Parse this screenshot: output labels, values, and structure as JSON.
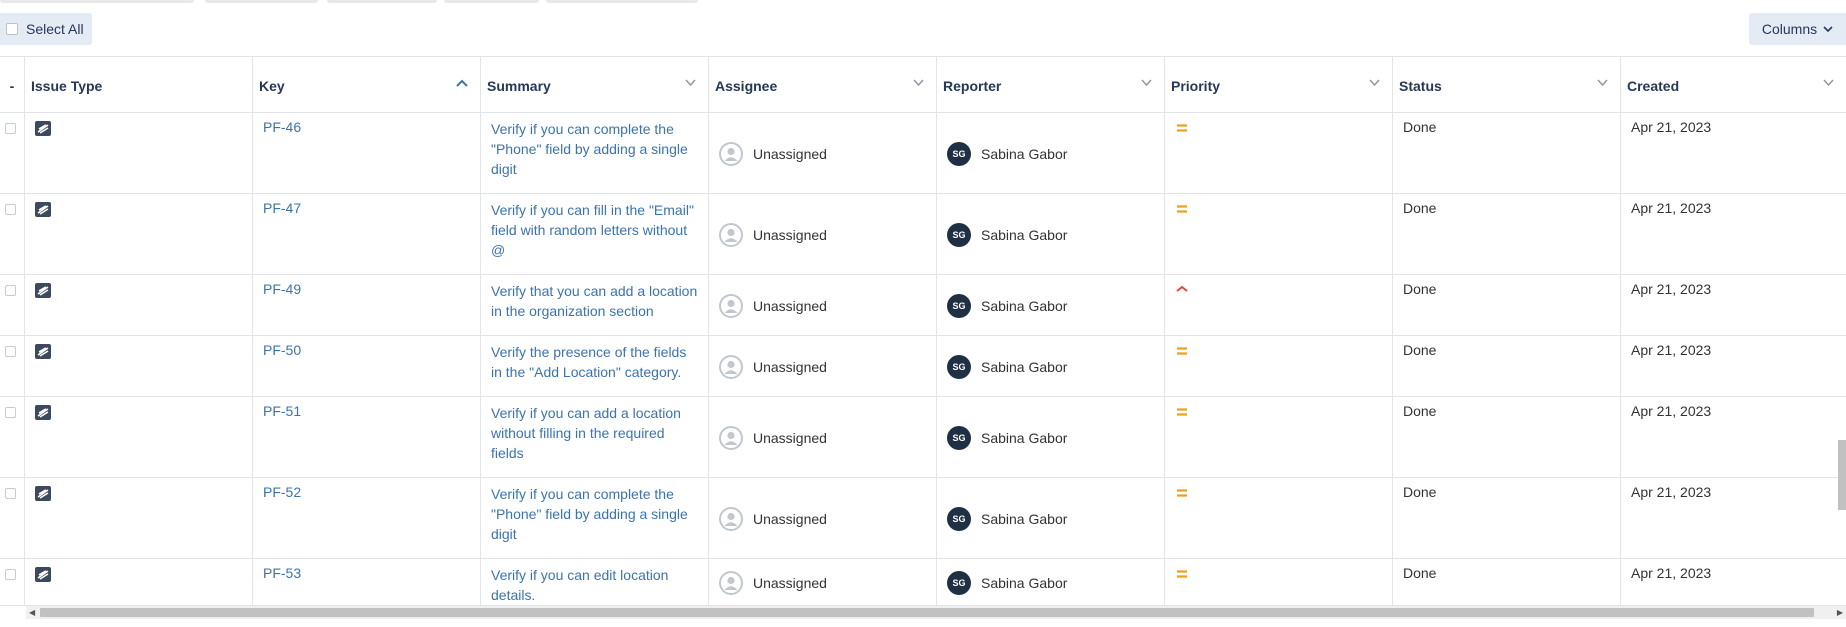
{
  "toolbar": {
    "select_all_label": "Select All",
    "columns_label": "Columns"
  },
  "table": {
    "headers": [
      "-",
      "Issue Type",
      "Key",
      "Summary",
      "Assignee",
      "Reporter",
      "Priority",
      "Status",
      "Created"
    ],
    "sorted_column": "Key",
    "sort_direction": "ascending",
    "rows": [
      {
        "issue_type": "test-icon",
        "key": "PF-46",
        "summary": "Verify if you can complete the \"Phone\" field by adding a single digit",
        "assignee": "Unassigned",
        "reporter_initials": "SG",
        "reporter": "Sabina Gabor",
        "priority": "medium",
        "status": "Done",
        "created": "Apr 21, 2023"
      },
      {
        "issue_type": "test-icon",
        "key": "PF-47",
        "summary": "Verify if you can fill in the \"Email\" field with random letters without @",
        "assignee": "Unassigned",
        "reporter_initials": "SG",
        "reporter": "Sabina Gabor",
        "priority": "medium",
        "status": "Done",
        "created": "Apr 21, 2023"
      },
      {
        "issue_type": "test-icon",
        "key": "PF-49",
        "summary": "Verify that you can add a location in the organization section",
        "assignee": "Unassigned",
        "reporter_initials": "SG",
        "reporter": "Sabina Gabor",
        "priority": "high",
        "status": "Done",
        "created": "Apr 21, 2023"
      },
      {
        "issue_type": "test-icon",
        "key": "PF-50",
        "summary": "Verify the presence of the fields in the \"Add Location\" category.",
        "assignee": "Unassigned",
        "reporter_initials": "SG",
        "reporter": "Sabina Gabor",
        "priority": "medium",
        "status": "Done",
        "created": "Apr 21, 2023"
      },
      {
        "issue_type": "test-icon",
        "key": "PF-51",
        "summary": "Verify if you can add a location without filling in the required fields",
        "assignee": "Unassigned",
        "reporter_initials": "SG",
        "reporter": "Sabina Gabor",
        "priority": "medium",
        "status": "Done",
        "created": "Apr 21, 2023"
      },
      {
        "issue_type": "test-icon",
        "key": "PF-52",
        "summary": "Verify if you can complete the \"Phone\" field by adding a single digit",
        "assignee": "Unassigned",
        "reporter_initials": "SG",
        "reporter": "Sabina Gabor",
        "priority": "medium",
        "status": "Done",
        "created": "Apr 21, 2023"
      },
      {
        "issue_type": "test-icon",
        "key": "PF-53",
        "summary": "Verify if you can edit location details.",
        "assignee": "Unassigned",
        "reporter_initials": "SG",
        "reporter": "Sabina Gabor",
        "priority": "medium",
        "status": "Done",
        "created": "Apr 21, 2023"
      }
    ]
  },
  "colors": {
    "link": "#3b73af",
    "priority_medium": "#f0a11a",
    "priority_high": "#e2483d",
    "reporter_avatar": "#1f2f44",
    "button_bg": "#e4ebf5"
  }
}
